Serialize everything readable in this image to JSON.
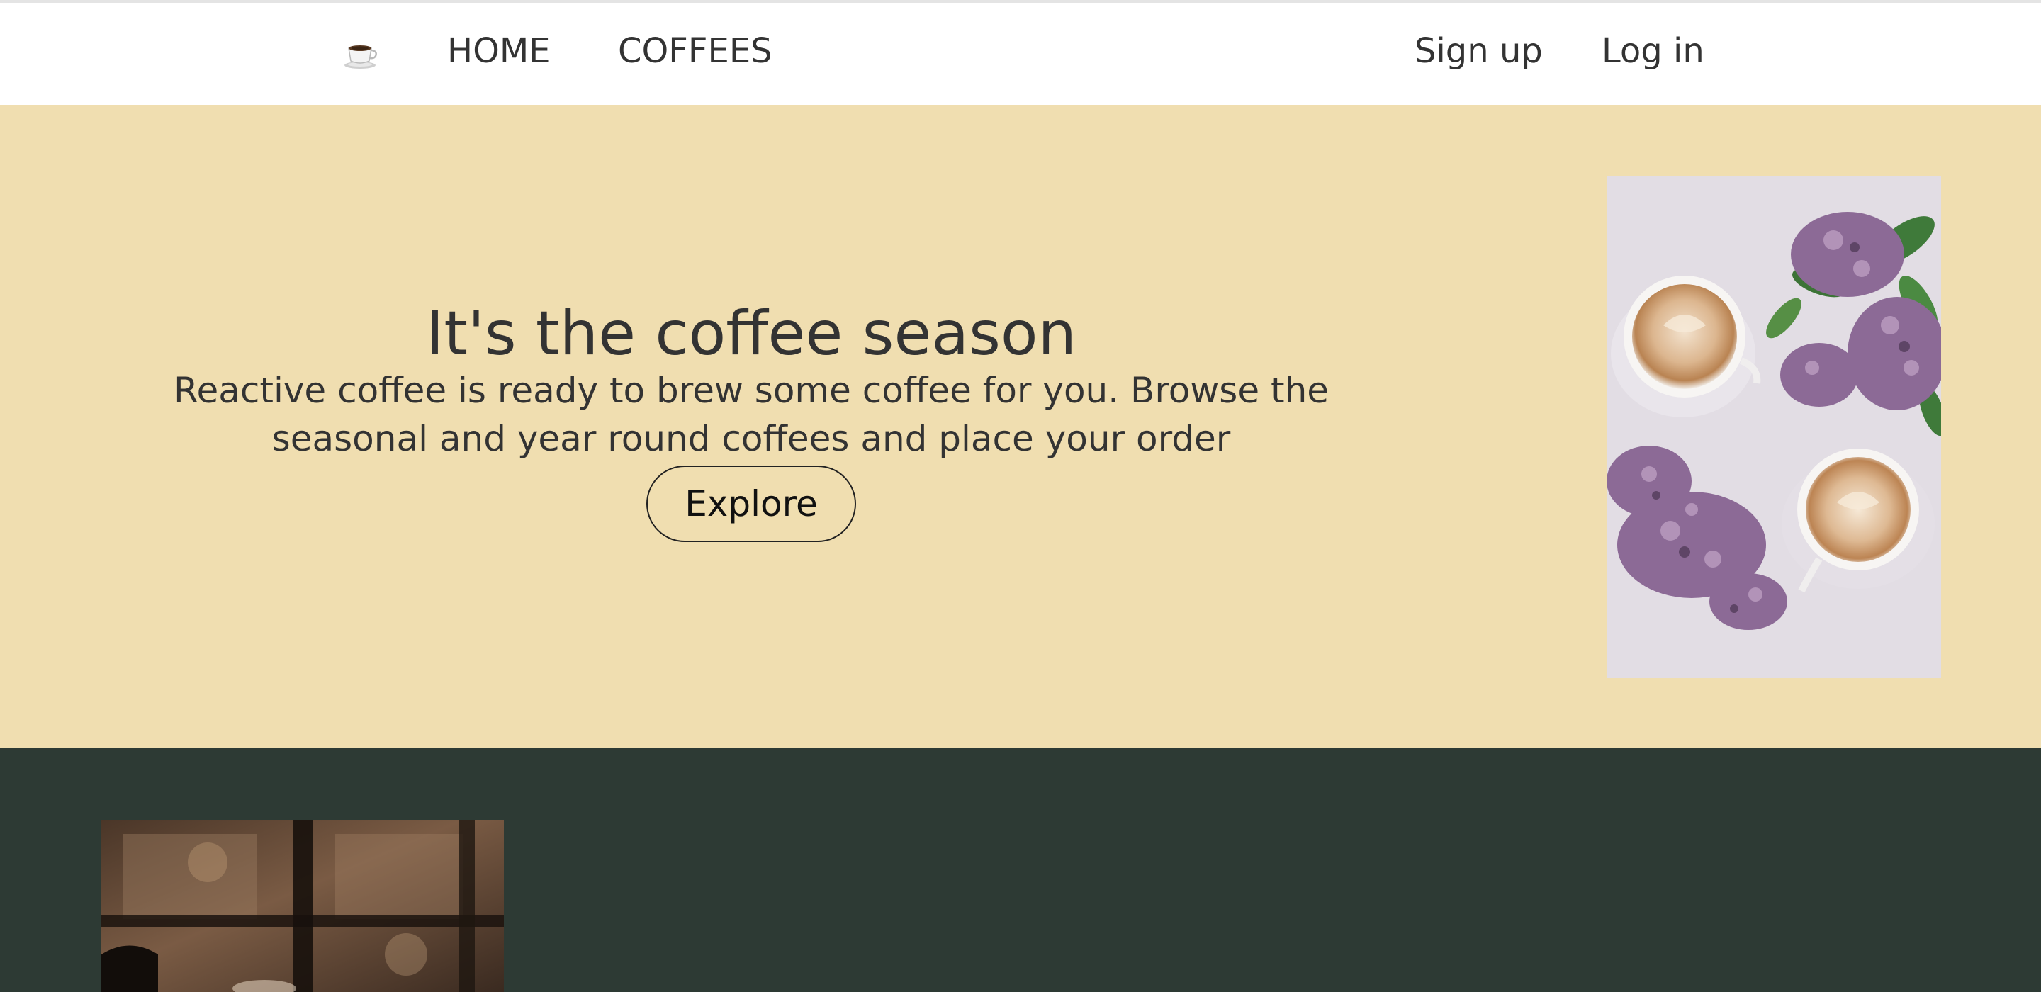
{
  "nav": {
    "logo_icon": "coffee-cup-icon",
    "items": [
      {
        "label": "HOME"
      },
      {
        "label": "COFFEES"
      }
    ],
    "signup_label": "Sign up",
    "login_label": "Log in"
  },
  "hero": {
    "title": "It's the coffee season",
    "description": "Reactive coffee is ready to brew some coffee for you. Browse the seasonal and year round coffees and place your order",
    "explore_label": "Explore",
    "image_subject": "two lattes with lilac flowers"
  },
  "section2": {
    "image_subject": "cafe window blurred"
  },
  "colors": {
    "nav_background": "#ffffff",
    "hero_background": "#f0deb0",
    "dark_section_background": "#2d3a34",
    "text": "#333333"
  }
}
